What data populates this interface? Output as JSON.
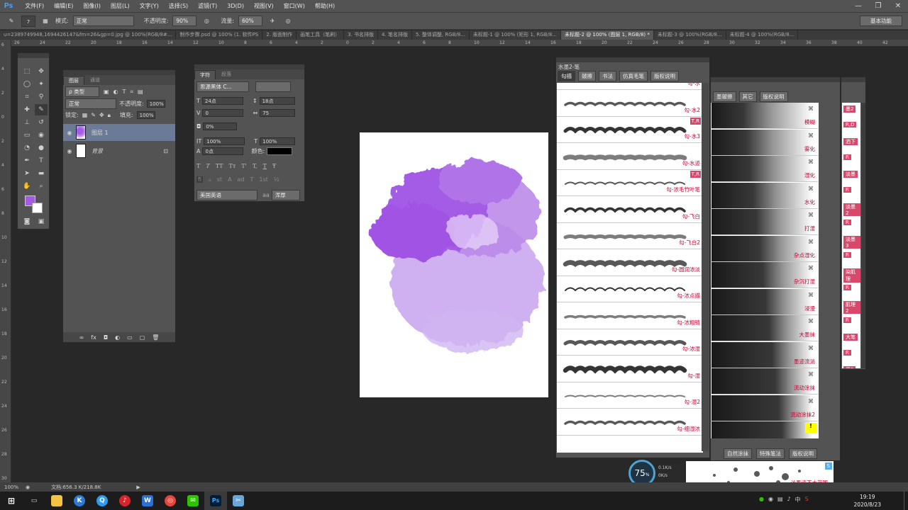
{
  "app": {
    "logo": "Ps"
  },
  "menu": [
    "文件(F)",
    "编辑(E)",
    "图像(I)",
    "图层(L)",
    "文字(Y)",
    "选择(S)",
    "滤镜(T)",
    "3D(D)",
    "视图(V)",
    "窗口(W)",
    "帮助(H)"
  ],
  "options": {
    "brush_size": "7",
    "mode_label": "模式:",
    "mode_value": "正常",
    "opacity_label": "不透明度:",
    "opacity_value": "90%",
    "flow_label": "流量:",
    "flow_value": "60%",
    "workspace": "基本功能"
  },
  "doc_tabs": [
    "u=2389749948,1694426147&fm=26&gp=0.jpg @ 100%(RGB/8#...",
    "制作步骤.psd @ 100% (1. 软件PS",
    "2. 版面制作",
    "画笔工具（笔刷）",
    "3. 书名排版",
    "4. 笔名排版",
    "5. 整体调整, RGB/8...",
    "未标题-1 @ 100% (矩形 1, RGB/8...",
    "未标题-2 @ 100% (图层 1, RGB/8) *",
    "未标题-3 @ 100%(RGB/8...",
    "未标题-4 @ 100%(RGB/8..."
  ],
  "ruler_top": [
    "26",
    "24",
    "22",
    "20",
    "18",
    "16",
    "14",
    "12",
    "10",
    "8",
    "6",
    "4",
    "2",
    "0",
    "2",
    "4",
    "6",
    "8",
    "10",
    "12",
    "14",
    "16",
    "18",
    "20",
    "22",
    "24",
    "26",
    "28",
    "30",
    "32",
    "34",
    "36",
    "38",
    "40",
    "42",
    "44"
  ],
  "ruler_left": [
    "6",
    "4",
    "2",
    "0",
    "2",
    "4",
    "6",
    "8",
    "10",
    "12",
    "14",
    "16",
    "18",
    "20",
    "22",
    "24",
    "26",
    "28",
    "30",
    "32"
  ],
  "layers": {
    "tabs": [
      "图层",
      "通道"
    ],
    "filter_kind": "ρ 类型",
    "blend_mode": "正常",
    "opacity_label": "不透明度:",
    "opacity_value": "100%",
    "lock_label": "锁定:",
    "fill_label": "填充:",
    "fill_value": "100%",
    "rows": [
      {
        "name": "图层 1"
      },
      {
        "name": "背景"
      }
    ]
  },
  "character": {
    "tabs": [
      "字符",
      "段落"
    ],
    "font_family": "思源黑体 C...",
    "font_style": "-",
    "font_size": "24点",
    "leading": "18点",
    "kerning": "0",
    "tracking": "75",
    "tsume": "0%",
    "vscale": "100%",
    "hscale": "100%",
    "baseline": "0点",
    "color_label": "颜色:",
    "style_buttons": [
      "T",
      "T",
      "TT",
      "Tт",
      "T'",
      "T,",
      "T",
      "Ŧ"
    ],
    "opentype_buttons": [
      "fi",
      "ℴ",
      "st",
      "A",
      "ad",
      "T",
      "1st",
      "½"
    ],
    "language": "美国英语",
    "aa_label": "aa",
    "aa_value": "浑厚"
  },
  "brushA": {
    "title": "水墨2-笔",
    "tabs": [
      "勾描",
      "皴擦",
      "书法",
      "仿真毛笔",
      "版权说明"
    ],
    "items": [
      {
        "name": "勾-水",
        "badge": ""
      },
      {
        "name": "勾-水2",
        "badge": ""
      },
      {
        "name": "勾-水3",
        "badge": "T,R"
      },
      {
        "name": "勾-水迹",
        "badge": ""
      },
      {
        "name": "勾-浓毛竹叶笔",
        "badge": "T,R"
      },
      {
        "name": "勾-飞白",
        "badge": ""
      },
      {
        "name": "勾-飞白2",
        "badge": ""
      },
      {
        "name": "勾-圆润浓淡",
        "badge": ""
      },
      {
        "name": "勾-浓点描",
        "badge": ""
      },
      {
        "name": "勾-浓粗链",
        "badge": ""
      },
      {
        "name": "勾-浓湿",
        "badge": ""
      },
      {
        "name": "勾-湿",
        "badge": ""
      },
      {
        "name": "勾-湿2",
        "badge": ""
      },
      {
        "name": "勾-细湿浓",
        "badge": ""
      }
    ]
  },
  "brushB": {
    "tabs": [
      "墨皴擦",
      "其它",
      "版权说明"
    ],
    "items": [
      "模糊",
      "雾化",
      "湿化",
      "水化",
      "打湿",
      "杂点湿化",
      "杂沉打湿",
      "浸漫",
      "大墨抹",
      "墨迹流淌",
      "流动涂抹",
      "流动涂抹2",
      ""
    ],
    "bottom_tabs": [
      "自然涂抹",
      "特殊笔法",
      "版权说明"
    ],
    "bottom_preview_label": "淡墨渍下大范围",
    "bottom_badge": "S"
  },
  "brushC": {
    "items": [
      "墨2",
      "R,D",
      "洒下",
      "R",
      "淡墨",
      "R",
      "淡墨2",
      "R",
      "淡墨3",
      "R",
      "染肌理",
      "R",
      "肌理2",
      "R",
      "大笔",
      "R",
      "墨2",
      "R",
      "淡墨"
    ]
  },
  "status": {
    "zoom": "100%",
    "doc": "文档:656.3 K/218.8K"
  },
  "speed": {
    "percent": "75",
    "unit": "%",
    "up": "0.1K/s",
    "down": "0K/s"
  },
  "clock": {
    "time": "19:19",
    "date": "2020/8/23"
  },
  "taskbar_apps": [
    "start-icon",
    "taskview-icon",
    "explorer-icon",
    "kugou-icon",
    "qq-browser-icon",
    "netease-music-icon",
    "wps-icon",
    "game-icon",
    "wechat-icon",
    "photoshop-icon",
    "snipping-icon"
  ],
  "colors": {
    "foreground": "#a45ce6",
    "background": "#ffffff",
    "accent_red": "#c4002f",
    "badge_pink": "#d9476b"
  }
}
